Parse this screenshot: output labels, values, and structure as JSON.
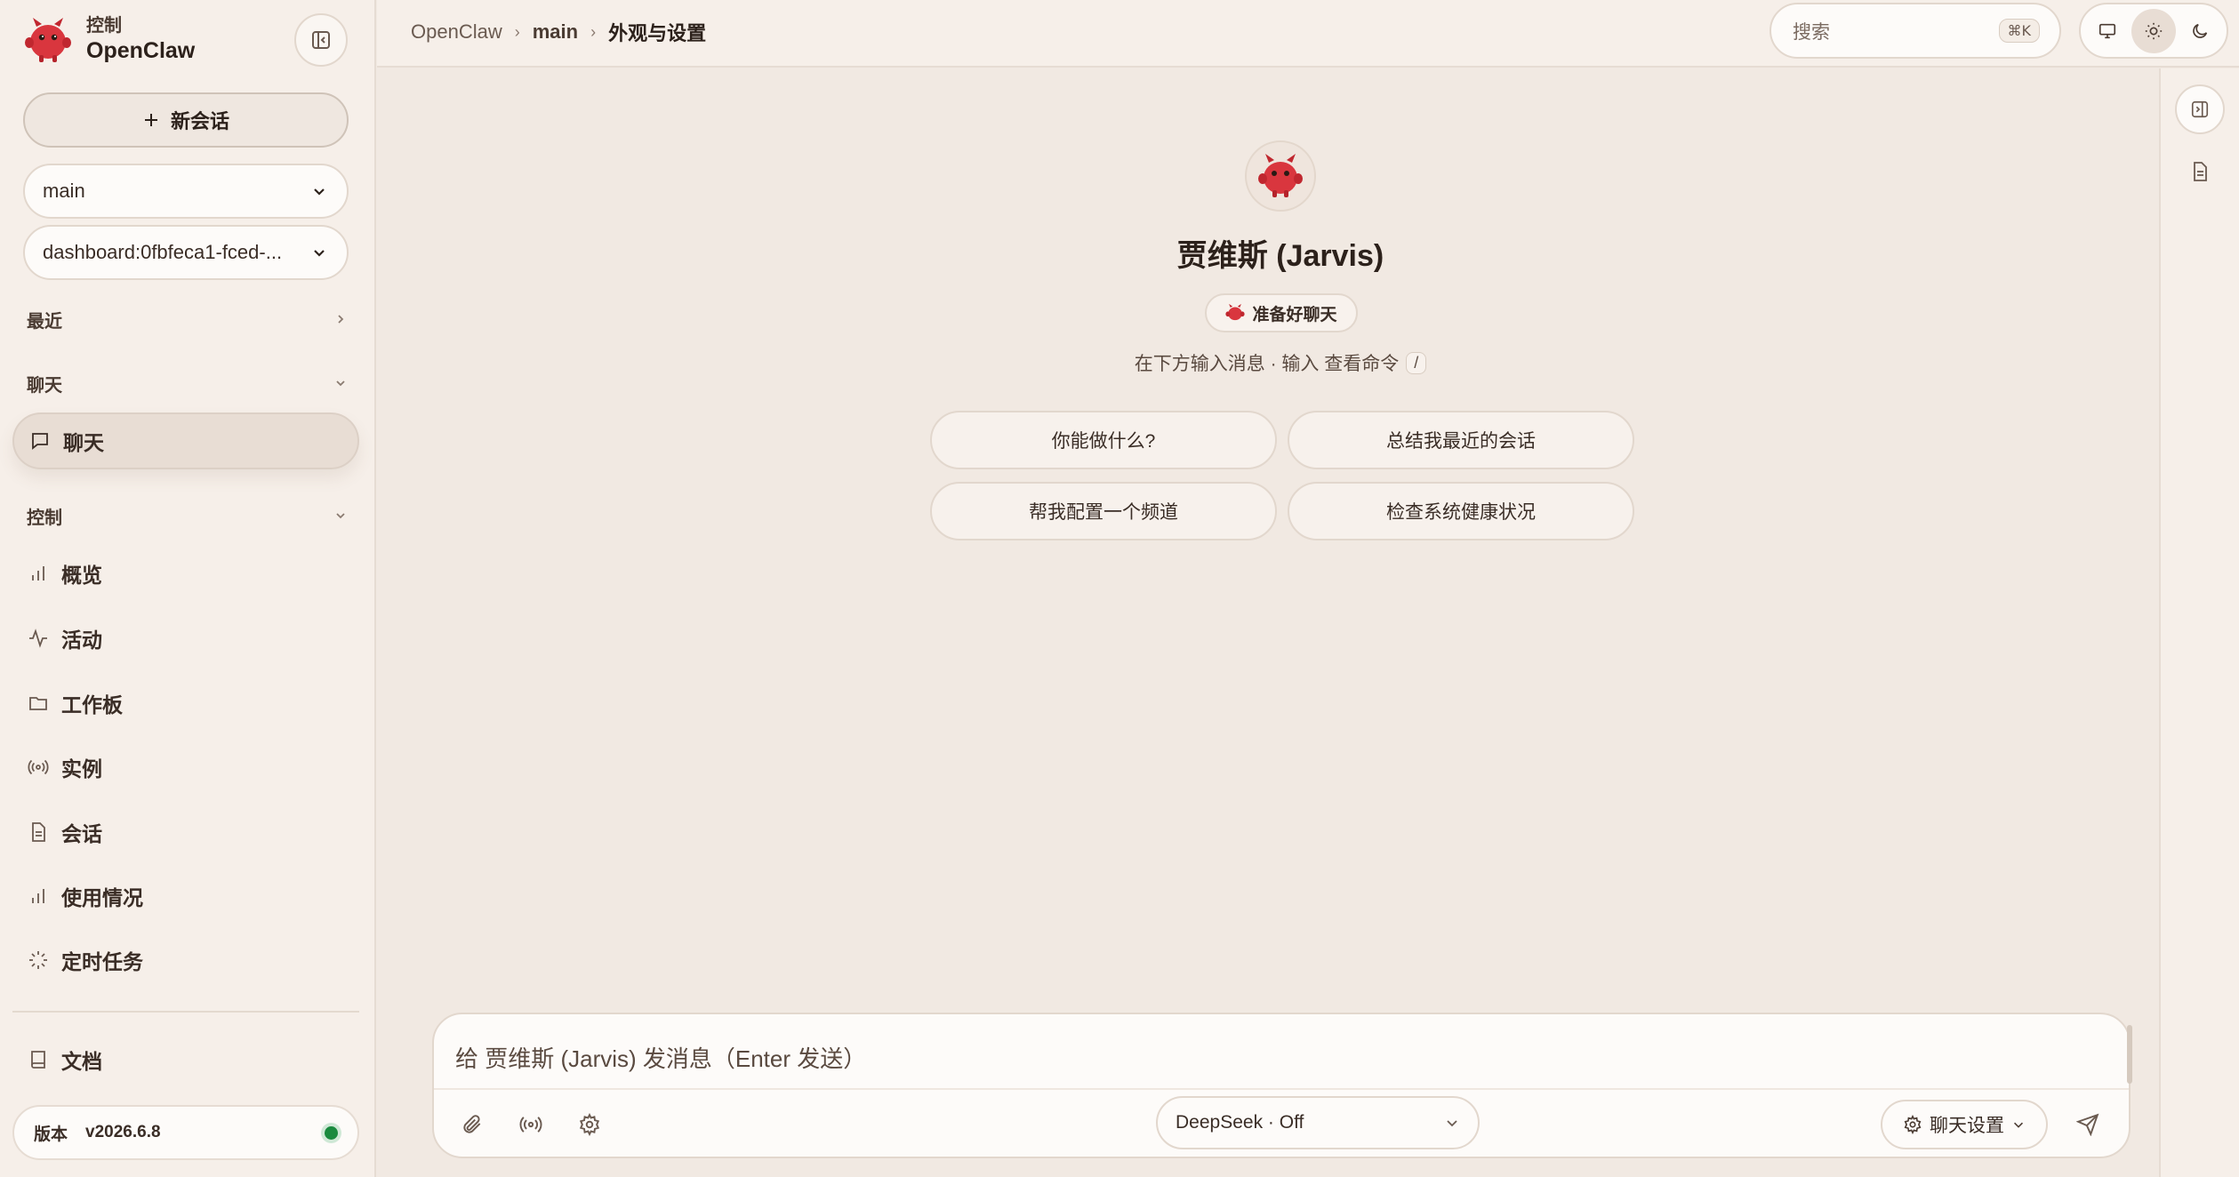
{
  "brand": {
    "subtitle": "控制",
    "name": "OpenClaw"
  },
  "sidebar": {
    "new_chat_label": "新会话",
    "agent_select": "main",
    "session_select": "dashboard:0fbfeca1-fced-...",
    "sections": {
      "recent": "最近",
      "chat": "聊天",
      "control": "控制"
    },
    "chat_items": [
      {
        "label": "聊天",
        "icon": "message-square-icon"
      }
    ],
    "control_items": [
      {
        "label": "概览",
        "icon": "bar-chart-icon"
      },
      {
        "label": "活动",
        "icon": "activity-icon"
      },
      {
        "label": "工作板",
        "icon": "folder-icon"
      },
      {
        "label": "实例",
        "icon": "radio-icon"
      },
      {
        "label": "会话",
        "icon": "file-text-icon"
      },
      {
        "label": "使用情况",
        "icon": "bar-chart-icon"
      },
      {
        "label": "定时任务",
        "icon": "loader-icon"
      }
    ],
    "docs_label": "文档",
    "version_key": "版本",
    "version_value": "v2026.6.8"
  },
  "topbar": {
    "breadcrumb": [
      "OpenClaw",
      "main",
      "外观与设置"
    ],
    "search_placeholder": "搜索",
    "search_shortcut": "⌘K"
  },
  "main": {
    "agent_name": "贾维斯 (Jarvis)",
    "status_label": "准备好聊天",
    "hint_text": "在下方输入消息 · 输入 查看命令",
    "hint_key": "/",
    "suggestions": [
      "你能做什么?",
      "总结我最近的会话",
      "帮我配置一个频道",
      "检查系统健康状况"
    ]
  },
  "composer": {
    "placeholder": "给 贾维斯 (Jarvis) 发消息（Enter 发送）",
    "model_label": "DeepSeek · Off",
    "chat_settings_label": "聊天设置"
  },
  "colors": {
    "background": "#f1e9e2",
    "sidebar": "#f6efe9",
    "accent_red": "#d9363e",
    "status_green": "#1a8a3e"
  }
}
